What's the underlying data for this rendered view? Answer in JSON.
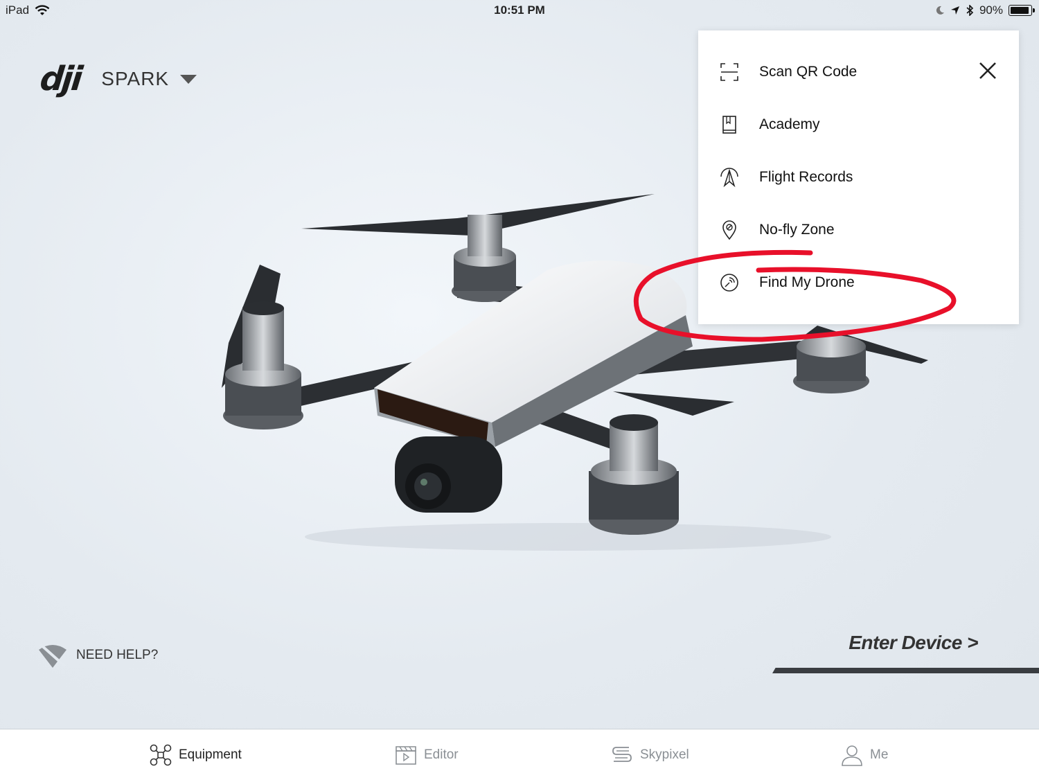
{
  "status_bar": {
    "device": "iPad",
    "time": "10:51 PM",
    "battery": "90%",
    "battery_level": 0.9
  },
  "header": {
    "logo_text": "dji",
    "model": "SPARK"
  },
  "menu": {
    "items": [
      {
        "label": "Scan QR Code",
        "icon": "qr-scan-icon"
      },
      {
        "label": "Academy",
        "icon": "book-icon"
      },
      {
        "label": "Flight Records",
        "icon": "flight-records-icon"
      },
      {
        "label": "No-fly Zone",
        "icon": "location-pin-icon"
      },
      {
        "label": "Find My Drone",
        "icon": "radar-icon"
      }
    ],
    "close_icon": "close-icon"
  },
  "annotation_color": "#e8102a",
  "need_help": {
    "label": "NEED HELP?",
    "icon": "no-signal-icon"
  },
  "enter_device": {
    "label": "Enter Device >"
  },
  "tabbar": {
    "tabs": [
      {
        "label": "Equipment",
        "icon": "drone-icon",
        "active": true
      },
      {
        "label": "Editor",
        "icon": "clapperboard-icon",
        "active": false
      },
      {
        "label": "Skypixel",
        "icon": "skypixel-icon",
        "active": false
      },
      {
        "label": "Me",
        "icon": "user-icon",
        "active": false
      }
    ]
  }
}
